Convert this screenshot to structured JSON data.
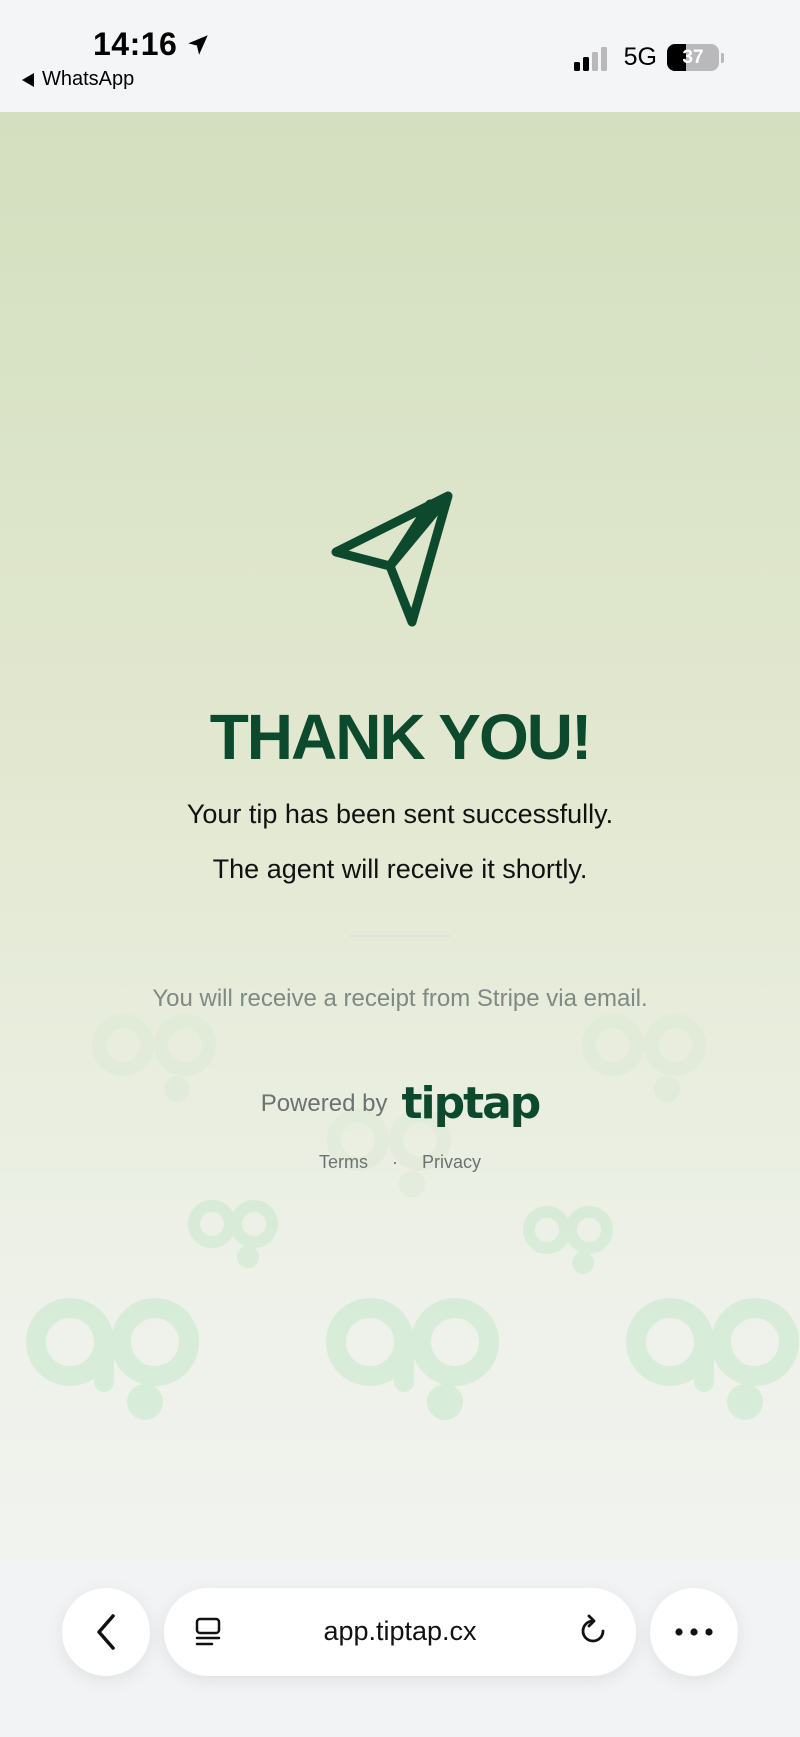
{
  "status_bar": {
    "time": "14:16",
    "back_app": "WhatsApp",
    "network": "5G",
    "battery_percent": "37",
    "battery_level": 0.37,
    "signal_bars_active": 2,
    "signal_bars_total": 4
  },
  "main": {
    "title": "THANK YOU!",
    "message_line1": "Your tip has been sent successfully.",
    "message_line2": "The agent will receive it shortly.",
    "receipt_note": "You will receive a receipt from Stripe via email.",
    "powered_by_label": "Powered by",
    "brand_name": "tiptap",
    "links": {
      "terms": "Terms",
      "separator": "·",
      "privacy": "Privacy"
    }
  },
  "browser": {
    "url": "app.tiptap.cx"
  },
  "icons": {
    "location": "location-arrow-icon",
    "back_app": "back-triangle-icon",
    "hero": "paper-plane-icon",
    "reader": "reader-mode-icon",
    "reload": "reload-icon",
    "back": "chevron-left-icon",
    "more": "more-dots-icon"
  },
  "colors": {
    "brand_green": "#0d4a2d",
    "watermark_green": "#c5e8cc"
  }
}
